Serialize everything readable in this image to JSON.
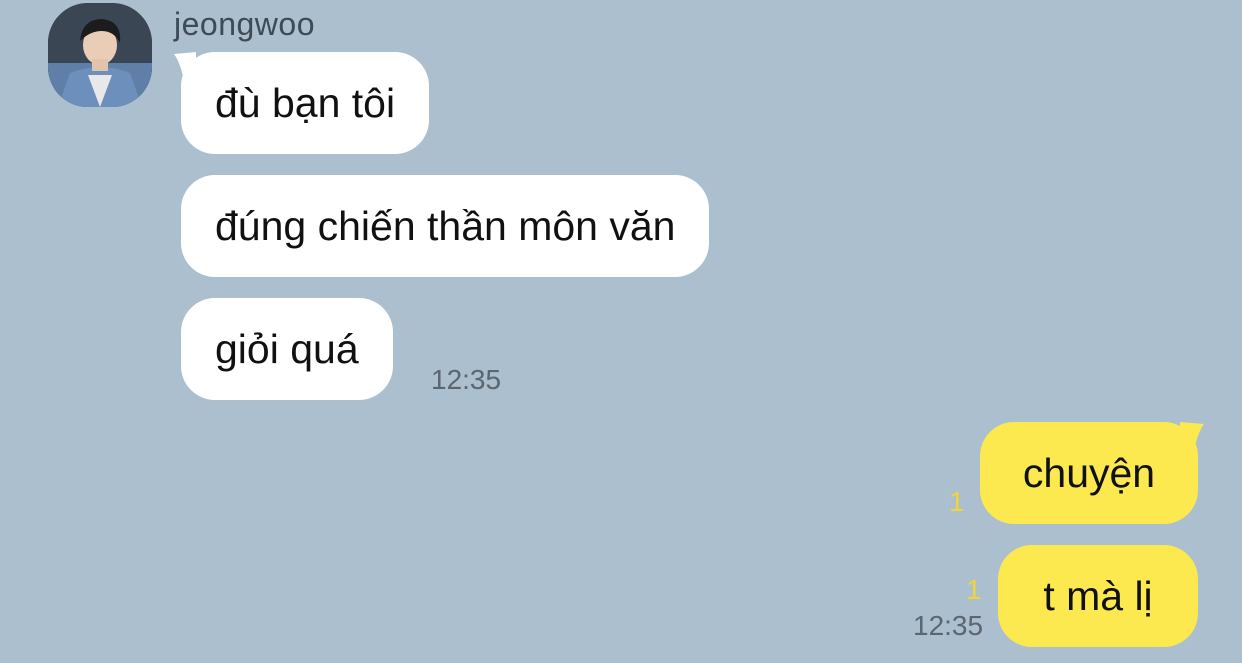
{
  "colors": {
    "background": "#abbfcf",
    "incoming_bubble": "#ffffff",
    "outgoing_bubble": "#fbe94f",
    "unread_count": "#f2d43a",
    "timestamp": "#5a6670"
  },
  "sender": {
    "name": "jeongwoo",
    "avatar_icon": "profile-photo"
  },
  "incoming": {
    "messages": [
      "đù bạn tôi",
      "đúng chiến thần môn văn",
      "giỏi quá"
    ],
    "time": "12:35"
  },
  "outgoing": {
    "messages": [
      "chuyện",
      "t mà lị"
    ],
    "unread": [
      "1",
      "1"
    ],
    "time": "12:35"
  }
}
